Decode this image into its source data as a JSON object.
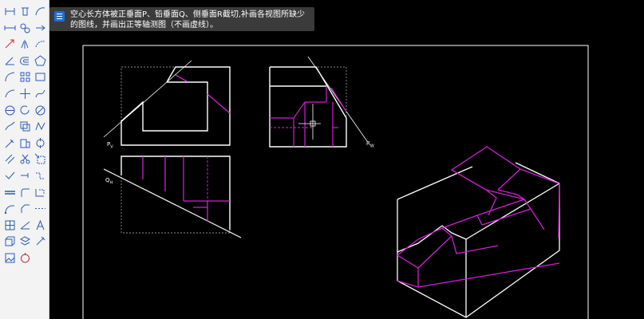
{
  "app": {
    "tooltip_text": "空心长方体被正垂面P、铅垂面Q、侧垂面R截切,补画各视图所缺少的图线，并画出正等轴测图（不画虚线）。"
  },
  "toolbar": {
    "tools": [
      {
        "icon": "dimension-linear-icon"
      },
      {
        "icon": "delete-icon"
      },
      {
        "icon": "arc-tool-icon"
      },
      {
        "icon": "dimension-aligned-icon"
      },
      {
        "icon": "circles-icon"
      },
      {
        "icon": "arrow-right-icon"
      },
      {
        "icon": "move-icon"
      },
      {
        "icon": "mirror-icon"
      },
      {
        "icon": "arc-dashed-icon"
      },
      {
        "icon": "dimension-angle-icon"
      },
      {
        "icon": "offset-icon"
      },
      {
        "icon": "pentagon-icon"
      },
      {
        "icon": "curve-icon"
      },
      {
        "icon": "array-icon"
      },
      {
        "icon": "rectangle-icon"
      },
      {
        "icon": "arc-tool-2-icon"
      },
      {
        "icon": "move-arrows-icon"
      },
      {
        "icon": "spline-icon"
      },
      {
        "icon": "circle-horizontal-icon"
      },
      {
        "icon": "rotate-icon"
      },
      {
        "icon": "circle-tangent-icon"
      },
      {
        "icon": "trim-icon"
      },
      {
        "icon": "copy-icon"
      },
      {
        "icon": "polyline-icon"
      },
      {
        "icon": "pen-tool-icon"
      },
      {
        "icon": "block-icon"
      },
      {
        "icon": "measure-icon"
      },
      {
        "icon": "parallel-lines-icon"
      },
      {
        "icon": "scissors-icon"
      },
      {
        "icon": "stretch-icon"
      },
      {
        "icon": "line-tool-icon"
      },
      {
        "icon": "extend-icon"
      },
      {
        "icon": "dimension-break-icon"
      },
      {
        "icon": "double-line-icon"
      },
      {
        "icon": "fillet-icon"
      },
      {
        "icon": "dimension-style-icon"
      },
      {
        "icon": "polyline-arc-icon"
      },
      {
        "icon": "chamfer-icon"
      },
      {
        "icon": "dashed-line-icon"
      },
      {
        "icon": "table-icon"
      },
      {
        "icon": "slope-icon"
      },
      {
        "icon": "text-icon"
      },
      {
        "icon": "extrude-icon"
      },
      {
        "icon": "layers-icon"
      },
      {
        "icon": "pick-icon"
      },
      {
        "icon": "image-icon"
      },
      {
        "icon": "revolve-icon"
      }
    ]
  },
  "drawing": {
    "labels": {
      "plane_p": "P",
      "plane_p_sub": "V",
      "plane_q": "Q",
      "plane_q_sub": "H",
      "plane_r": "R",
      "plane_r_sub": "W"
    },
    "colors": {
      "outline": "#ffffff",
      "added_lines": "#d21fd2",
      "hidden": "#d21fd2",
      "border": "#ffffff"
    }
  }
}
